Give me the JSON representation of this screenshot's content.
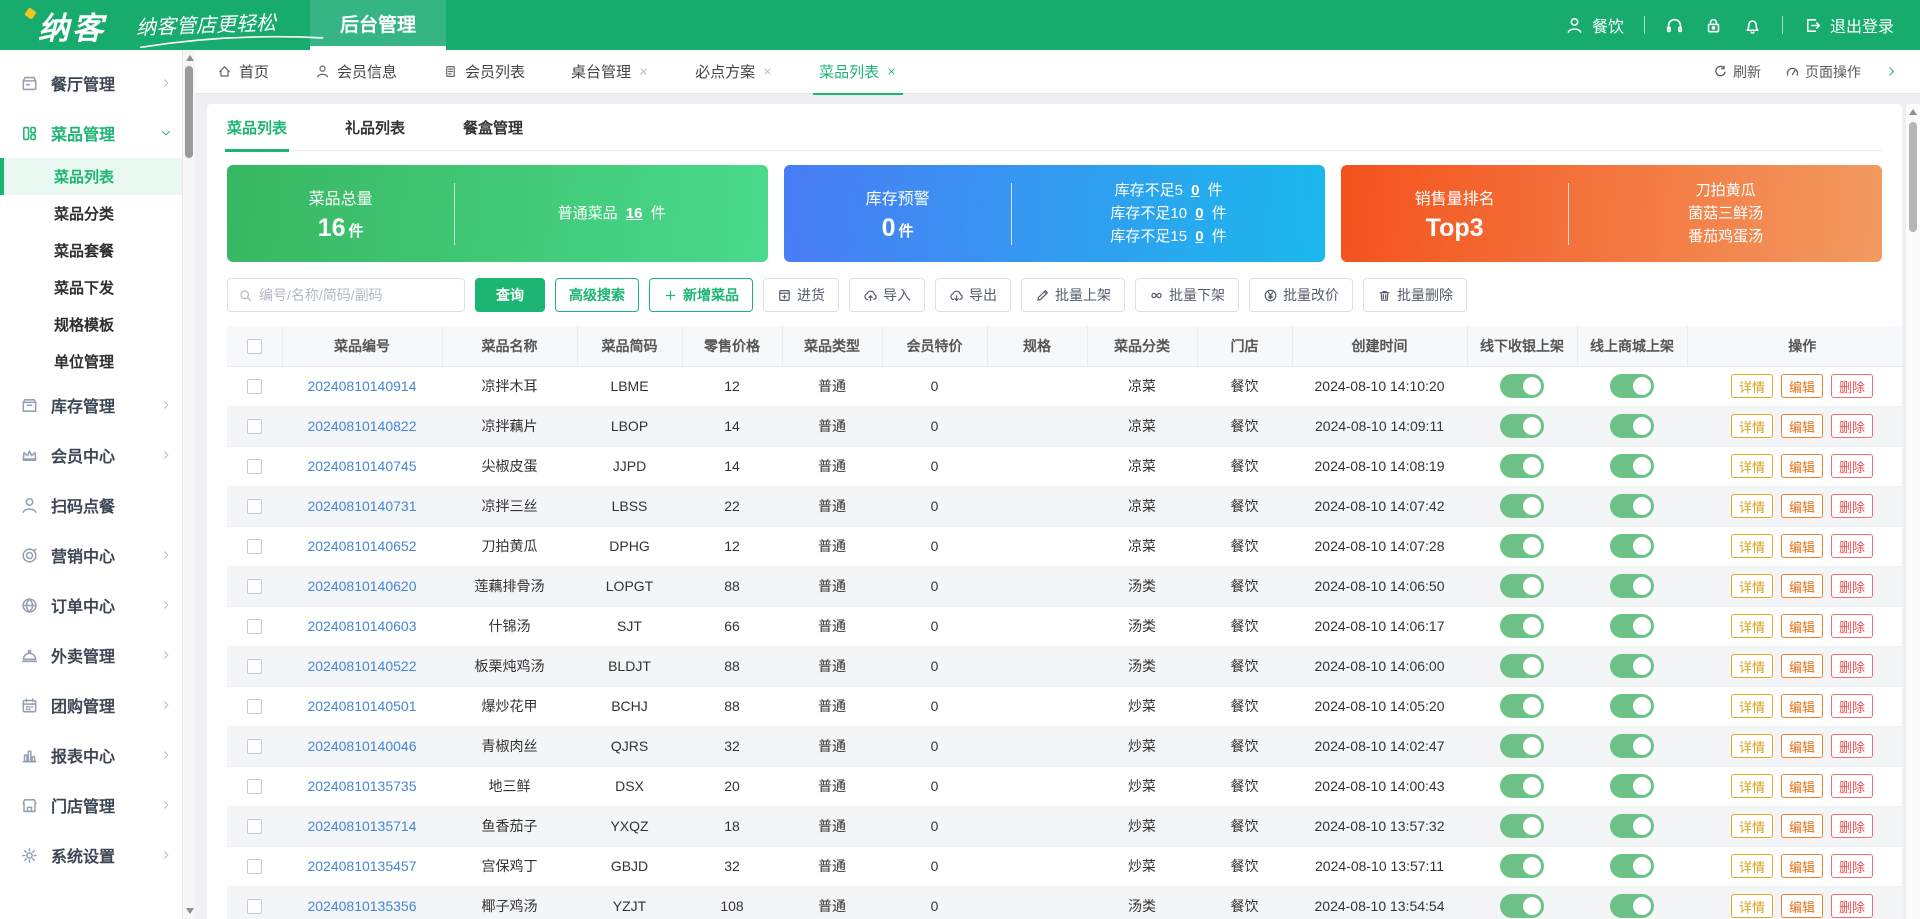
{
  "header": {
    "logo": "纳客",
    "slogan": "纳客管店更轻松",
    "nav_tab": "后台管理",
    "user": "餐饮",
    "logout": "退出登录",
    "icons": [
      "user-icon",
      "headset-icon",
      "lock-icon",
      "bell-icon",
      "logout-icon"
    ]
  },
  "sidebar": {
    "items": [
      {
        "label": "餐厅管理",
        "icon": "restaurant-icon",
        "chevron": "right"
      },
      {
        "label": "菜品管理",
        "icon": "dishes-icon",
        "chevron": "down",
        "active": true,
        "children": [
          {
            "label": "菜品列表",
            "active": true
          },
          {
            "label": "菜品分类"
          },
          {
            "label": "菜品套餐"
          },
          {
            "label": "菜品下发"
          },
          {
            "label": "规格模板"
          },
          {
            "label": "单位管理"
          }
        ]
      },
      {
        "label": "库存管理",
        "icon": "inventory-icon",
        "chevron": "right"
      },
      {
        "label": "会员中心",
        "icon": "crown-icon",
        "chevron": "right"
      },
      {
        "label": "扫码点餐",
        "icon": "person-icon"
      },
      {
        "label": "营销中心",
        "icon": "target-icon",
        "chevron": "right"
      },
      {
        "label": "订单中心",
        "icon": "globe-icon",
        "chevron": "right"
      },
      {
        "label": "外卖管理",
        "icon": "cloche-icon",
        "chevron": "right"
      },
      {
        "label": "团购管理",
        "icon": "calendar-icon",
        "chevron": "right"
      },
      {
        "label": "报表中心",
        "icon": "chart-icon",
        "chevron": "right"
      },
      {
        "label": "门店管理",
        "icon": "store-icon",
        "chevron": "right"
      },
      {
        "label": "系统设置",
        "icon": "gear-icon",
        "chevron": "right"
      }
    ]
  },
  "tabbar": {
    "tabs": [
      {
        "label": "首页",
        "icon": "home-icon"
      },
      {
        "label": "会员信息",
        "icon": "user-icon"
      },
      {
        "label": "会员列表",
        "icon": "doc-icon"
      },
      {
        "label": "桌台管理",
        "closable": true
      },
      {
        "label": "必点方案",
        "closable": true
      },
      {
        "label": "菜品列表",
        "closable": true,
        "active": true
      }
    ],
    "refresh": "刷新",
    "page_ops": "页面操作"
  },
  "subtabs": [
    {
      "label": "菜品列表",
      "active": true
    },
    {
      "label": "礼品列表"
    },
    {
      "label": "餐盒管理"
    }
  ],
  "cards": [
    {
      "title": "菜品总量",
      "value": "16",
      "unit": "件",
      "items": [
        {
          "label": "普通菜品",
          "value": "16",
          "unit": "件"
        }
      ]
    },
    {
      "title": "库存预警",
      "value": "0",
      "unit": "件",
      "items": [
        {
          "label": "库存不足5",
          "value": "0",
          "unit": "件"
        },
        {
          "label": "库存不足10",
          "value": "0",
          "unit": "件"
        },
        {
          "label": "库存不足15",
          "value": "0",
          "unit": "件"
        }
      ]
    },
    {
      "title": "销售量排名",
      "value": "Top3",
      "unit": "",
      "items": [
        {
          "label": "刀拍黄瓜"
        },
        {
          "label": "菌菇三鲜汤"
        },
        {
          "label": "番茄鸡蛋汤"
        }
      ]
    }
  ],
  "toolbar": {
    "search_placeholder": "编号/名称/简码/副码",
    "buttons": [
      {
        "name": "search-button",
        "label": "查询",
        "style": "solid"
      },
      {
        "name": "advanced-search-button",
        "label": "高级搜索",
        "style": "outline"
      },
      {
        "name": "add-dish-button",
        "label": "新增菜品",
        "style": "outline",
        "icon": "plus-icon"
      },
      {
        "name": "purchase-button",
        "label": "进货",
        "style": "plain",
        "icon": "purchase-icon"
      },
      {
        "name": "import-button",
        "label": "导入",
        "style": "plain",
        "icon": "import-icon"
      },
      {
        "name": "export-button",
        "label": "导出",
        "style": "plain",
        "icon": "export-icon"
      },
      {
        "name": "batch-on-shelf-button",
        "label": "批量上架",
        "style": "plain",
        "icon": "pencil-icon"
      },
      {
        "name": "batch-off-shelf-button",
        "label": "批量下架",
        "style": "plain",
        "icon": "link-icon"
      },
      {
        "name": "batch-price-button",
        "label": "批量改价",
        "style": "plain",
        "icon": "yen-icon"
      },
      {
        "name": "batch-delete-button",
        "label": "批量删除",
        "style": "plain",
        "icon": "trash-icon"
      }
    ]
  },
  "table": {
    "columns": [
      {
        "key": "checkbox",
        "label": ""
      },
      {
        "key": "code",
        "label": "菜品编号"
      },
      {
        "key": "name",
        "label": "菜品名称"
      },
      {
        "key": "shortcode",
        "label": "菜品简码"
      },
      {
        "key": "price",
        "label": "零售价格"
      },
      {
        "key": "type",
        "label": "菜品类型"
      },
      {
        "key": "member_price",
        "label": "会员特价"
      },
      {
        "key": "spec",
        "label": "规格"
      },
      {
        "key": "category",
        "label": "菜品分类"
      },
      {
        "key": "store",
        "label": "门店"
      },
      {
        "key": "created",
        "label": "创建时间"
      },
      {
        "key": "offline",
        "label": "线下收银上架"
      },
      {
        "key": "online",
        "label": "线上商城上架"
      },
      {
        "key": "ops",
        "label": "操作"
      }
    ],
    "actions": [
      "详情",
      "编辑",
      "删除"
    ],
    "rows": [
      {
        "code": "20240810140914",
        "name": "凉拌木耳",
        "shortcode": "LBME",
        "price": "12",
        "type": "普通",
        "member_price": "0",
        "spec": "",
        "category": "凉菜",
        "store": "餐饮",
        "created": "2024-08-10 14:10:20",
        "offline": true,
        "online": true
      },
      {
        "code": "20240810140822",
        "name": "凉拌藕片",
        "shortcode": "LBOP",
        "price": "14",
        "type": "普通",
        "member_price": "0",
        "spec": "",
        "category": "凉菜",
        "store": "餐饮",
        "created": "2024-08-10 14:09:11",
        "offline": true,
        "online": true
      },
      {
        "code": "20240810140745",
        "name": "尖椒皮蛋",
        "shortcode": "JJPD",
        "price": "14",
        "type": "普通",
        "member_price": "0",
        "spec": "",
        "category": "凉菜",
        "store": "餐饮",
        "created": "2024-08-10 14:08:19",
        "offline": true,
        "online": true
      },
      {
        "code": "20240810140731",
        "name": "凉拌三丝",
        "shortcode": "LBSS",
        "price": "22",
        "type": "普通",
        "member_price": "0",
        "spec": "",
        "category": "凉菜",
        "store": "餐饮",
        "created": "2024-08-10 14:07:42",
        "offline": true,
        "online": true
      },
      {
        "code": "20240810140652",
        "name": "刀拍黄瓜",
        "shortcode": "DPHG",
        "price": "12",
        "type": "普通",
        "member_price": "0",
        "spec": "",
        "category": "凉菜",
        "store": "餐饮",
        "created": "2024-08-10 14:07:28",
        "offline": true,
        "online": true
      },
      {
        "code": "20240810140620",
        "name": "莲藕排骨汤",
        "shortcode": "LOPGT",
        "price": "88",
        "type": "普通",
        "member_price": "0",
        "spec": "",
        "category": "汤类",
        "store": "餐饮",
        "created": "2024-08-10 14:06:50",
        "offline": true,
        "online": true
      },
      {
        "code": "20240810140603",
        "name": "什锦汤",
        "shortcode": "SJT",
        "price": "66",
        "type": "普通",
        "member_price": "0",
        "spec": "",
        "category": "汤类",
        "store": "餐饮",
        "created": "2024-08-10 14:06:17",
        "offline": true,
        "online": true
      },
      {
        "code": "20240810140522",
        "name": "板栗炖鸡汤",
        "shortcode": "BLDJT",
        "price": "88",
        "type": "普通",
        "member_price": "0",
        "spec": "",
        "category": "汤类",
        "store": "餐饮",
        "created": "2024-08-10 14:06:00",
        "offline": true,
        "online": true
      },
      {
        "code": "20240810140501",
        "name": "爆炒花甲",
        "shortcode": "BCHJ",
        "price": "88",
        "type": "普通",
        "member_price": "0",
        "spec": "",
        "category": "炒菜",
        "store": "餐饮",
        "created": "2024-08-10 14:05:20",
        "offline": true,
        "online": true
      },
      {
        "code": "20240810140046",
        "name": "青椒肉丝",
        "shortcode": "QJRS",
        "price": "32",
        "type": "普通",
        "member_price": "0",
        "spec": "",
        "category": "炒菜",
        "store": "餐饮",
        "created": "2024-08-10 14:02:47",
        "offline": true,
        "online": true
      },
      {
        "code": "20240810135735",
        "name": "地三鲜",
        "shortcode": "DSX",
        "price": "20",
        "type": "普通",
        "member_price": "0",
        "spec": "",
        "category": "炒菜",
        "store": "餐饮",
        "created": "2024-08-10 14:00:43",
        "offline": true,
        "online": true
      },
      {
        "code": "20240810135714",
        "name": "鱼香茄子",
        "shortcode": "YXQZ",
        "price": "18",
        "type": "普通",
        "member_price": "0",
        "spec": "",
        "category": "炒菜",
        "store": "餐饮",
        "created": "2024-08-10 13:57:32",
        "offline": true,
        "online": true
      },
      {
        "code": "20240810135457",
        "name": "宫保鸡丁",
        "shortcode": "GBJD",
        "price": "32",
        "type": "普通",
        "member_price": "0",
        "spec": "",
        "category": "炒菜",
        "store": "餐饮",
        "created": "2024-08-10 13:57:11",
        "offline": true,
        "online": true
      },
      {
        "code": "20240810135356",
        "name": "椰子鸡汤",
        "shortcode": "YZJT",
        "price": "108",
        "type": "普通",
        "member_price": "0",
        "spec": "",
        "category": "汤类",
        "store": "餐饮",
        "created": "2024-08-10 13:54:54",
        "offline": true,
        "online": true
      }
    ]
  },
  "colors": {
    "brand_green": "#17ab6e",
    "accent_green": "#1db573",
    "card_green": [
      "#38b761",
      "#49da8c"
    ],
    "card_blue": [
      "#4a7cf5",
      "#1bb9ec"
    ],
    "card_orange": [
      "#f4521d",
      "#f29b61"
    ],
    "link_blue": "#4585d6",
    "toggle_on": "#6cc287",
    "action_detail": "#d9a118",
    "action_edit": "#e8731c",
    "action_delete": "#ef4f4f"
  }
}
